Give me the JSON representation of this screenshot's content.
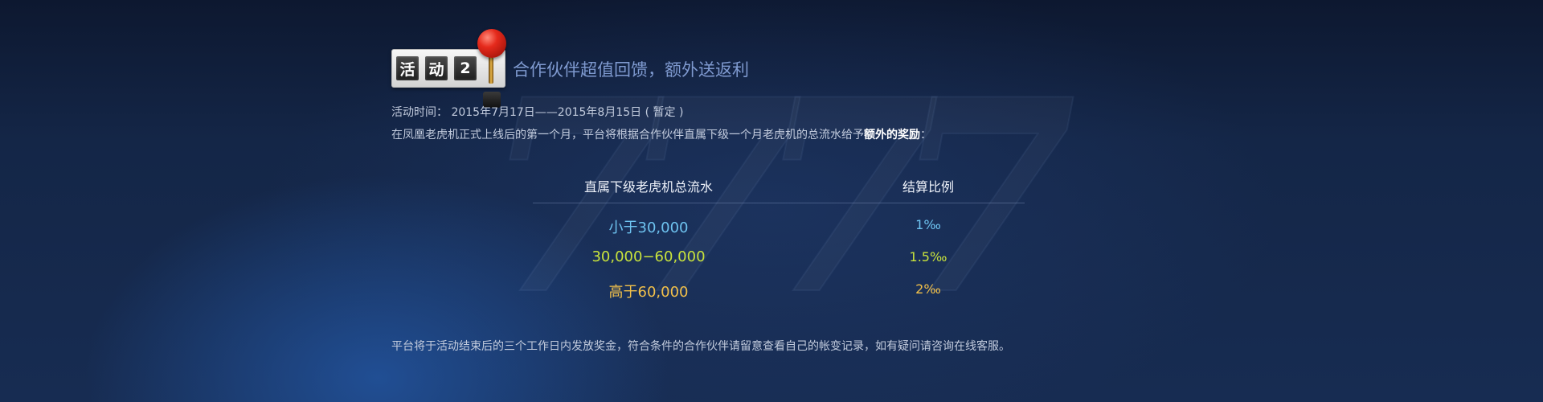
{
  "decoration": {
    "sevens": [
      "7",
      "7",
      "7",
      "7"
    ]
  },
  "heading": {
    "badge_reels": [
      "活",
      "动",
      "2"
    ],
    "title": "合作伙伴超值回馈，额外送返利"
  },
  "info": {
    "line1": "活动时间： 2015年7月17日——2015年8月15日 ( 暂定 )",
    "line2_prefix": "在凤凰老虎机正式上线后的第一个月，平台将根据合作伙伴直属下级一个月老虎机的总流水给予",
    "line2_bold": "额外的奖励",
    "line2_suffix": "："
  },
  "table": {
    "headers": [
      "直属下级老虎机总流水",
      "结算比例"
    ],
    "rows": [
      {
        "range": "小于30,000",
        "ratio": "1‰",
        "color": "#6ec3f0"
      },
      {
        "range": "30,000−60,000",
        "ratio": "1.5‰",
        "color": "#c8e23c"
      },
      {
        "range": "高于60,000",
        "ratio": "2‰",
        "color": "#f2c04a"
      }
    ]
  },
  "footer": "平台将于活动结束后的三个工作日内发放奖金，符合条件的合作伙伴请留意查看自己的帐变记录，如有疑问请咨询在线客服。"
}
